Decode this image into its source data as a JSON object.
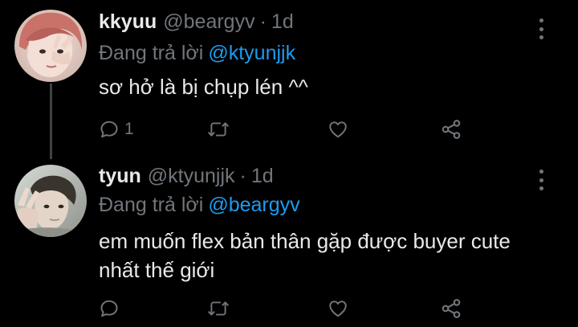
{
  "tweets": [
    {
      "display_name": "kkyuu",
      "handle": "@beargyv",
      "dot": "·",
      "time": "1d",
      "reply_prefix": "Đang trả lời",
      "reply_to": "@ktyunjjk",
      "text": "sơ hở là bị chụp lén ^^",
      "reply_count": "1",
      "retweet_count": "",
      "like_count": ""
    },
    {
      "display_name": "tyun",
      "handle": "@ktyunjjk",
      "dot": "·",
      "time": "1d",
      "reply_prefix": "Đang trả lời",
      "reply_to": "@beargyv",
      "text": "em muốn flex bản thân gặp được buyer cute nhất thế giới",
      "reply_count": "",
      "retweet_count": "",
      "like_count": ""
    }
  ],
  "colors": {
    "background": "#000000",
    "text_primary": "#e7e9ea",
    "text_secondary": "#71767b",
    "accent": "#1d9bf0",
    "thread_line": "#3d4246"
  },
  "icons": {
    "reply": "reply-icon",
    "retweet": "retweet-icon",
    "like": "heart-icon",
    "share": "share-icon",
    "more": "more-vertical-icon"
  }
}
